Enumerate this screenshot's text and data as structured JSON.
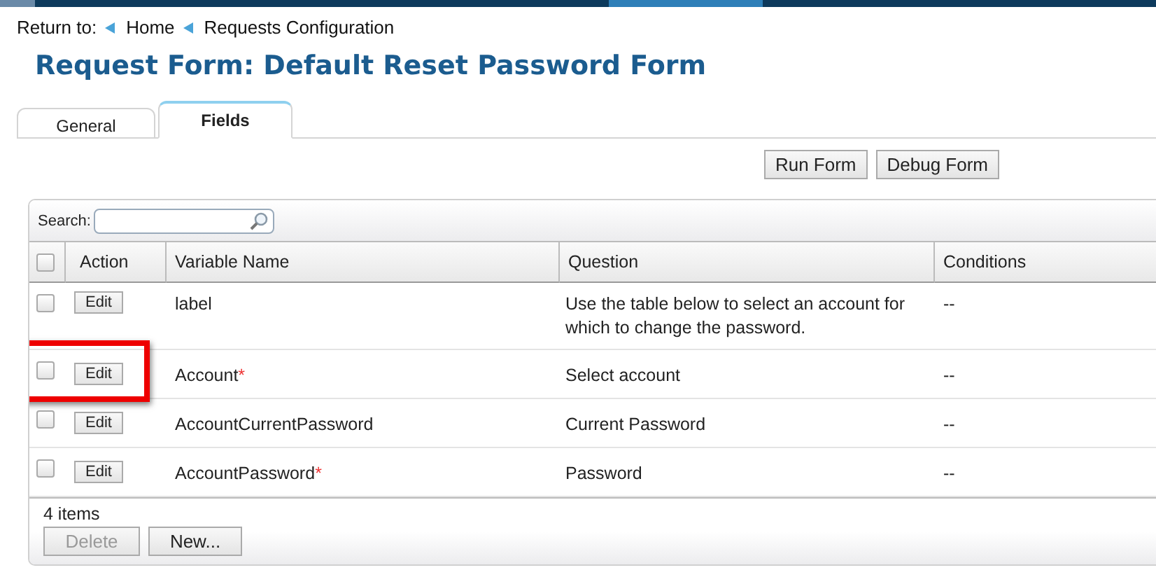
{
  "breadcrumb": {
    "label": "Return to:",
    "links": [
      "Home",
      "Requests Configuration"
    ]
  },
  "title": "Request Form: Default Reset Password Form",
  "tabs": [
    {
      "label": "General",
      "selected": false
    },
    {
      "label": "Fields",
      "selected": true
    }
  ],
  "actions": [
    "Run Form",
    "Debug Form"
  ],
  "search": {
    "label": "Search:"
  },
  "table": {
    "select_all": {
      "checked": false
    },
    "columns": [
      "Action",
      "Variable Name",
      "Question",
      "Conditions"
    ],
    "rows": [
      {
        "checked": false,
        "action": "Edit",
        "variable": "label",
        "question": "Use the table below to select an account for which to change the password.",
        "conditions": "--",
        "highlighted": false
      },
      {
        "checked": false,
        "action": "Edit",
        "variable": "Account",
        "required_mark": "*",
        "question": "Select account",
        "conditions": "--",
        "highlighted": true
      },
      {
        "checked": false,
        "action": "Edit",
        "variable": "AccountCurrentPassword",
        "question": "Current Password",
        "conditions": "--",
        "highlighted": false
      },
      {
        "checked": false,
        "action": "Edit",
        "variable": "AccountPassword",
        "required_mark": "*",
        "question": "Password",
        "conditions": "--",
        "highlighted": false
      }
    ]
  },
  "footer": {
    "count": "4 items",
    "buttons": [
      {
        "label": "Delete",
        "disabled": true
      },
      {
        "label": "New...",
        "disabled": false
      }
    ]
  }
}
